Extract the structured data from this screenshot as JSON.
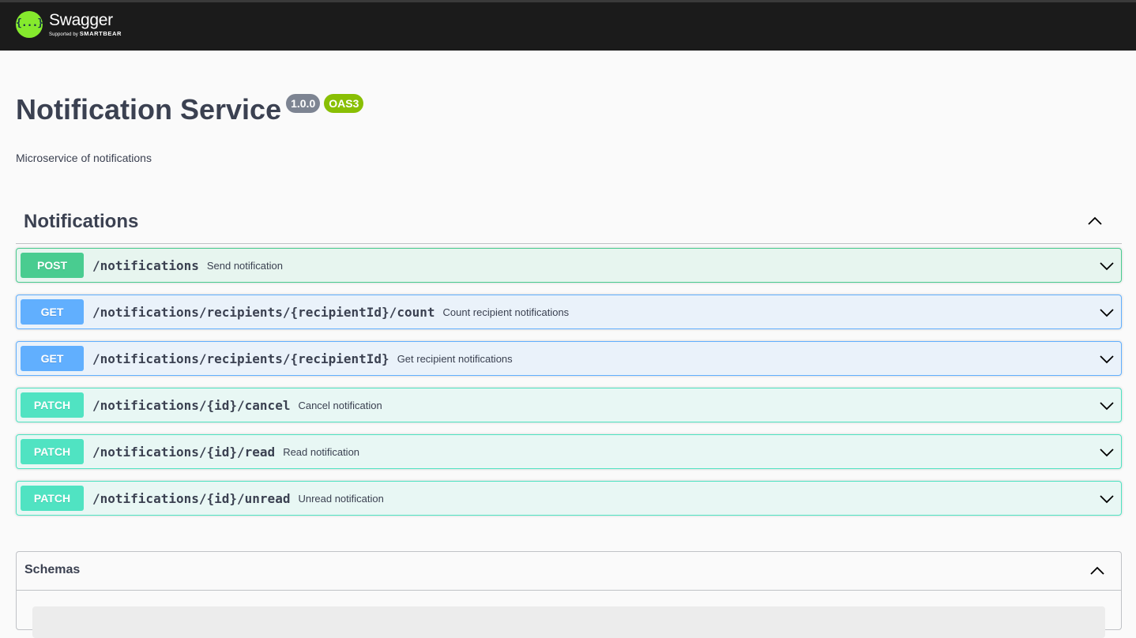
{
  "topbar": {
    "logo_title": "Swagger",
    "logo_supported_prefix": "Supported by",
    "logo_supported_brand": "SMARTBEAR",
    "logo_mark_glyph": "{...}",
    "background": "#1b1b1b",
    "logo_color": "#85ea2d"
  },
  "info": {
    "title": "Notification Service",
    "version": "1.0.0",
    "oas_badge": "OAS3",
    "description": "Microservice of notifications"
  },
  "tag": {
    "name": "Notifications",
    "expanded": true,
    "toggle_icon": "chevron-up-icon"
  },
  "operations": [
    {
      "method": "POST",
      "path": "/notifications",
      "summary": "Send notification",
      "color": "#49cc90"
    },
    {
      "method": "GET",
      "path": "/notifications/recipients/{recipientId}/count",
      "summary": "Count recipient notifications",
      "color": "#61affe"
    },
    {
      "method": "GET",
      "path": "/notifications/recipients/{recipientId}",
      "summary": "Get recipient notifications",
      "color": "#61affe"
    },
    {
      "method": "PATCH",
      "path": "/notifications/{id}/cancel",
      "summary": "Cancel notification",
      "color": "#50e3c2"
    },
    {
      "method": "PATCH",
      "path": "/notifications/{id}/read",
      "summary": "Read notification",
      "color": "#50e3c2"
    },
    {
      "method": "PATCH",
      "path": "/notifications/{id}/unread",
      "summary": "Unread notification",
      "color": "#50e3c2"
    }
  ],
  "schemas": {
    "title": "Schemas",
    "expanded": true,
    "toggle_icon": "chevron-up-icon"
  }
}
